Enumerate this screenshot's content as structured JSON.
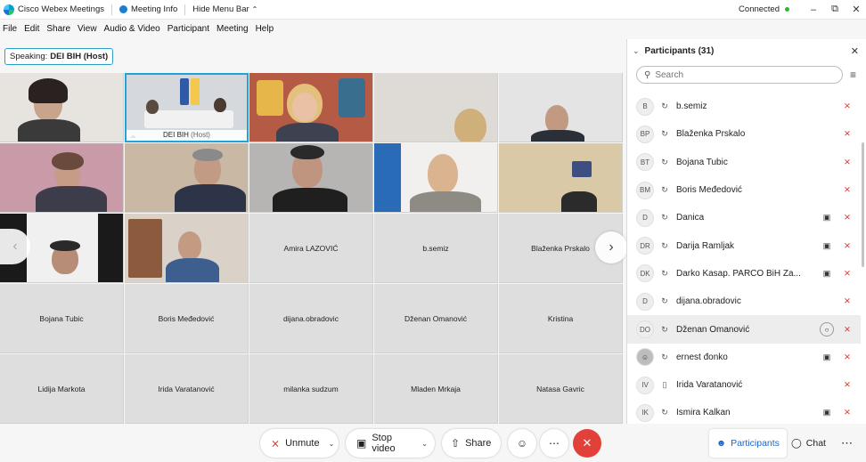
{
  "titlebar": {
    "app_name": "Cisco Webex Meetings",
    "meeting_info": "Meeting Info",
    "hide_menu_bar": "Hide Menu Bar",
    "status": "Connected"
  },
  "menu": [
    "File",
    "Edit",
    "Share",
    "View",
    "Audio & Video",
    "Participant",
    "Meeting",
    "Help"
  ],
  "speaking": {
    "label": "Speaking:",
    "name": "DEI BIH (Host)"
  },
  "grid": {
    "host_name": "DEI BIH",
    "host_tag": "(Host)",
    "name_tiles": [
      "Amira LAZOVIĆ",
      "b.semiz",
      "Blaženka Prskalo",
      "Bojana Tubic",
      "Boris Međedović",
      "dijana.obradovic",
      "Dženan Omanović",
      "Kristina",
      "Lidija Markota",
      "Irida Varatanović",
      "milanka sudzum",
      "Mladen Mrkaja",
      "Natasa Gavric"
    ]
  },
  "panel": {
    "title": "Participants (31)",
    "search_placeholder": "Search",
    "participants": [
      {
        "initials": "B",
        "name": "b.semiz",
        "device": "pc",
        "video": false,
        "chat": false
      },
      {
        "initials": "BP",
        "name": "Blaženka Prskalo",
        "device": "pc",
        "video": false,
        "chat": false
      },
      {
        "initials": "BT",
        "name": "Bojana Tubic",
        "device": "pc",
        "video": false,
        "chat": false
      },
      {
        "initials": "BM",
        "name": "Boris Međedović",
        "device": "pc",
        "video": false,
        "chat": false
      },
      {
        "initials": "D",
        "name": "Danica",
        "device": "pc",
        "video": true,
        "chat": false
      },
      {
        "initials": "DR",
        "name": "Darija Ramljak",
        "device": "pc",
        "video": true,
        "chat": false
      },
      {
        "initials": "DK",
        "name": "Darko Kasap. PARCO BiH Za...",
        "device": "pc",
        "video": true,
        "chat": false
      },
      {
        "initials": "D",
        "name": "dijana.obradovic",
        "device": "pc",
        "video": false,
        "chat": false
      },
      {
        "initials": "DO",
        "name": "Dženan Omanović",
        "device": "pc",
        "video": false,
        "chat": true
      },
      {
        "initials": "",
        "name": "ernest đonko",
        "device": "pc",
        "video": true,
        "chat": false
      },
      {
        "initials": "IV",
        "name": "Irida Varatanović",
        "device": "phone",
        "video": false,
        "chat": false
      },
      {
        "initials": "IK",
        "name": "Ismira Kalkan",
        "device": "pc",
        "video": true,
        "chat": false
      }
    ]
  },
  "controls": {
    "unmute": "Unmute",
    "stop_video": "Stop video",
    "share": "Share",
    "participants": "Participants",
    "chat": "Chat"
  },
  "colors": {
    "accent": "#1fa3d9",
    "end": "#e2413a",
    "muted": "#d9342b"
  }
}
